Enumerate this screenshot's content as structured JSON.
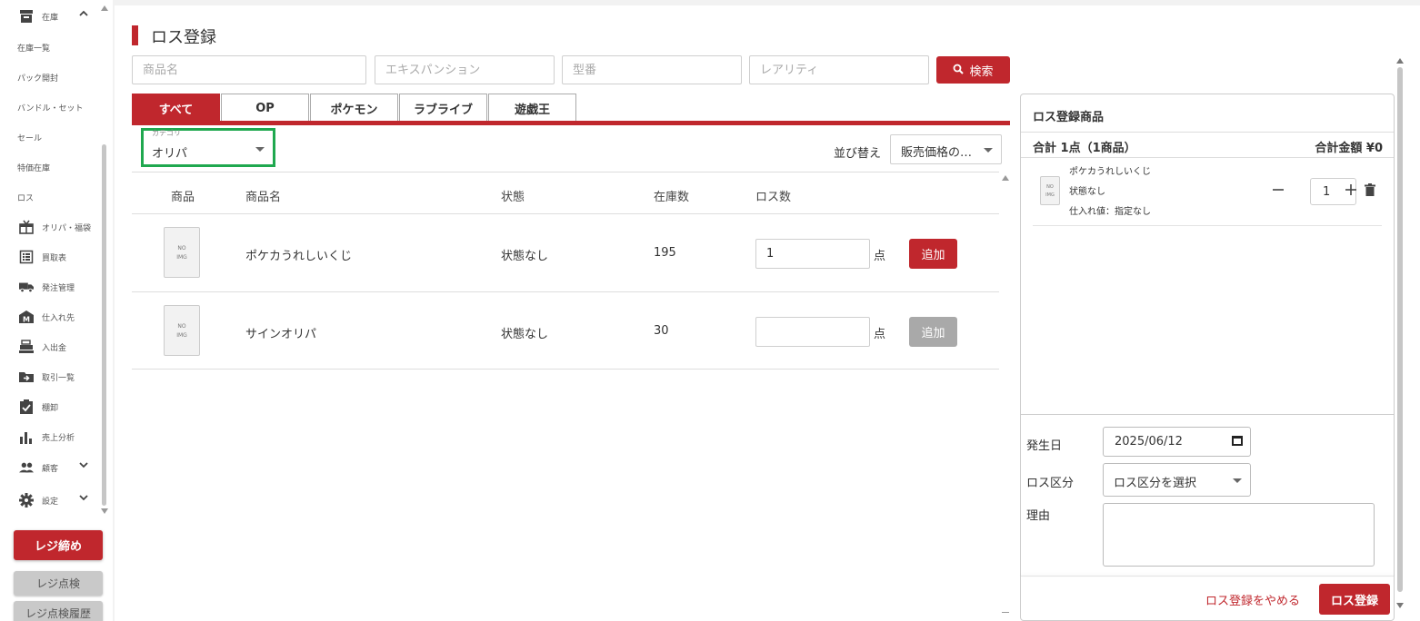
{
  "colors": {
    "accent": "#c0272d",
    "highlight": "#1fa84f",
    "disabled": "#a9a9a9"
  },
  "sidebar": {
    "items": [
      {
        "label": "在庫",
        "icon": "archive-icon",
        "expanded": true
      },
      {
        "label": "在庫一覧"
      },
      {
        "label": "パック開封"
      },
      {
        "label": "バンドル・セット"
      },
      {
        "label": "セール"
      },
      {
        "label": "特価在庫"
      },
      {
        "label": "ロス"
      },
      {
        "label": "オリパ・福袋",
        "icon": "gift-box-icon"
      },
      {
        "label": "買取表",
        "icon": "list-icon"
      },
      {
        "label": "発注管理",
        "icon": "truck-icon"
      },
      {
        "label": "仕入れ先",
        "icon": "warehouse-icon"
      },
      {
        "label": "入出金",
        "icon": "cash-register-icon"
      },
      {
        "label": "取引一覧",
        "icon": "folder-arrow-icon"
      },
      {
        "label": "棚卸",
        "icon": "clipboard-check-icon"
      },
      {
        "label": "売上分析",
        "icon": "bar-chart-icon"
      },
      {
        "label": "顧客",
        "icon": "people-icon"
      },
      {
        "label": "設定",
        "icon": "gear-icon"
      }
    ],
    "close_register": "レジ締め",
    "register_check": "レジ点検",
    "register_check_history": "レジ点検履歴"
  },
  "page": {
    "title": "ロス登録"
  },
  "search": {
    "product_name_placeholder": "商品名",
    "expansion_placeholder": "エキスパンション",
    "model_number_placeholder": "型番",
    "rarity_placeholder": "レアリティ",
    "button": "検索"
  },
  "tabs": [
    {
      "label": "すべて",
      "active": true
    },
    {
      "label": "OP"
    },
    {
      "label": "ポケモン"
    },
    {
      "label": "ラブライブ"
    },
    {
      "label": "遊戯王"
    }
  ],
  "category": {
    "label": "カテゴリ",
    "value": "オリパ"
  },
  "sort": {
    "label": "並び替え",
    "value": "販売価格の…"
  },
  "table": {
    "headers": [
      "商品",
      "商品名",
      "状態",
      "在庫数",
      "ロス数"
    ],
    "unit": "点",
    "add_label": "追加",
    "rows": [
      {
        "image": "NO IMG",
        "name": "ポケカうれしいくじ",
        "condition": "状態なし",
        "stock": "195",
        "loss": "1",
        "add_enabled": true
      },
      {
        "image": "NO IMG",
        "name": "サインオリパ",
        "condition": "状態なし",
        "stock": "30",
        "loss": "",
        "add_enabled": false
      }
    ]
  },
  "panel": {
    "title": "ロス登録商品",
    "total_count": "合計 1点（1商品）",
    "total_amount": "合計金額 ¥0",
    "items": [
      {
        "image": "NO IMG",
        "name": "ポケカうれしいくじ",
        "condition": "状態なし",
        "purchase_price": "仕入れ値：指定なし",
        "quantity": "1"
      }
    ],
    "form": {
      "date_label": "発生日",
      "date_value": "2025/06/12",
      "type_label": "ロス区分",
      "type_value": "ロス区分を選択",
      "reason_label": "理由"
    },
    "cancel": "ロス登録をやめる",
    "submit": "ロス登録"
  }
}
